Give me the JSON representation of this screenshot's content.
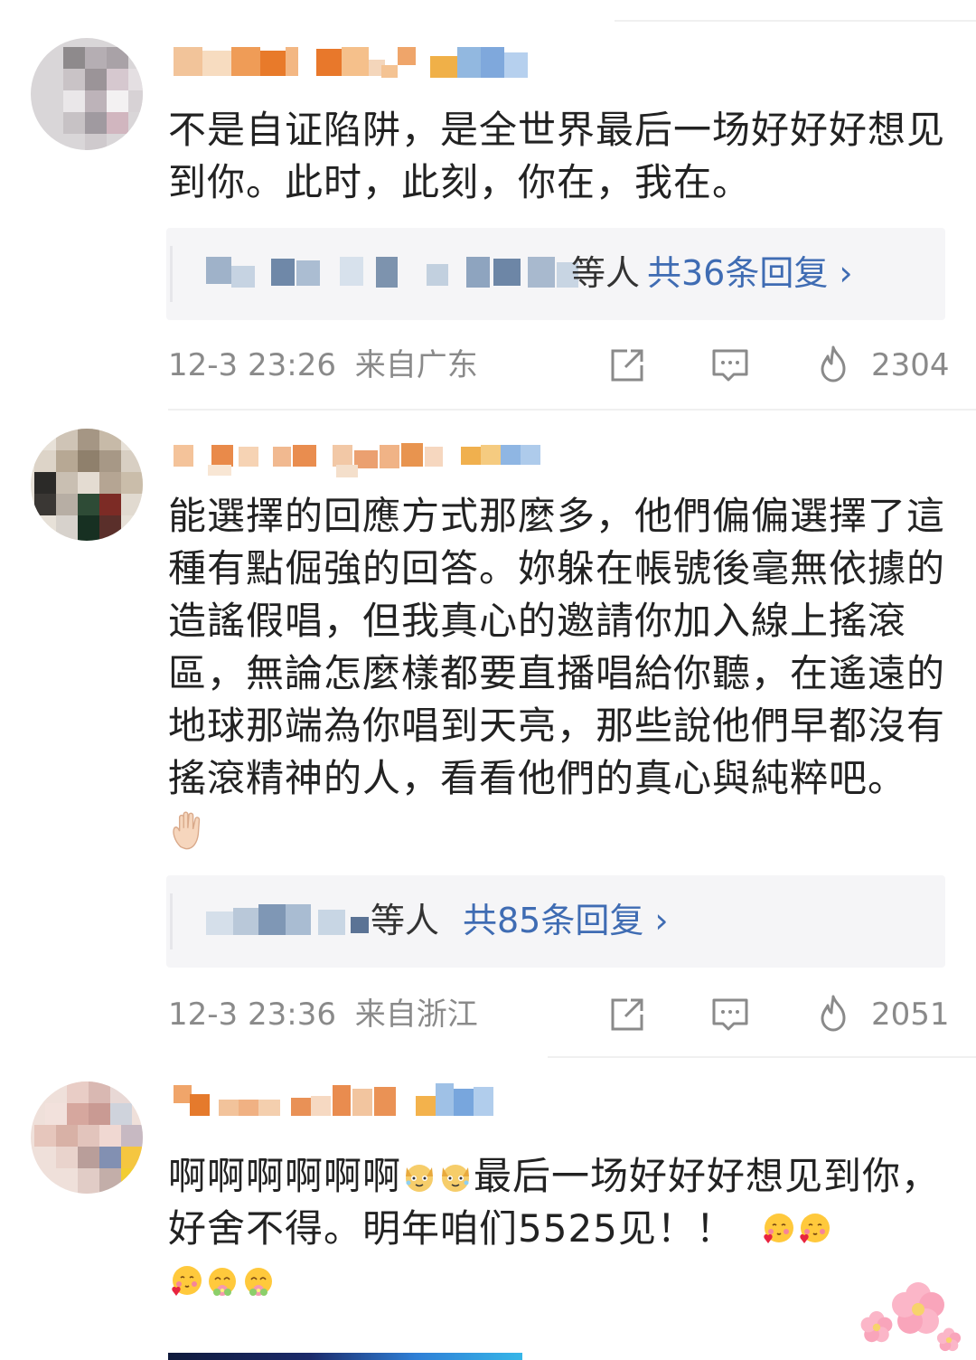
{
  "comments": [
    {
      "text": "不是自证陷阱，是全世界最后一场好好好想见到你。此时，此刻，你在，我在。",
      "replies": {
        "suffix": "等人",
        "count_label": "共36条回复 ›"
      },
      "meta": {
        "date": "12-3 23:26",
        "location": "来自广东"
      },
      "likes": "2304"
    },
    {
      "text": "能選擇的回應方式那麼多，他們偏偏選擇了這種有點倔強的回答。妳躲在帳號後毫無依據的造謠假唱，但我真心的邀請你加入線上搖滾區，無論怎麼樣都要直播唱給你聽，在遙遠的地球那端為你唱到天亮，那些說他們早都沒有搖滾精神的人，看看他們的真心與純粹吧。",
      "replies": {
        "suffix": "等人",
        "count_label": "共85条回复 ›"
      },
      "meta": {
        "date": "12-3 23:36",
        "location": "来自浙江"
      },
      "likes": "2051"
    },
    {
      "text_a": "啊啊啊啊啊啊",
      "text_b": "最后一场好好好想见到你，好舍不得。明年咱们5525见！！"
    }
  ],
  "icons": [
    "share-icon",
    "comment-icon",
    "like-flame-icon",
    "hand-emoji-icon",
    "dog-emoji-icon",
    "blush-heart-emoji-icon",
    "flower-emoji-icon",
    "blossom-sticker-icon"
  ]
}
